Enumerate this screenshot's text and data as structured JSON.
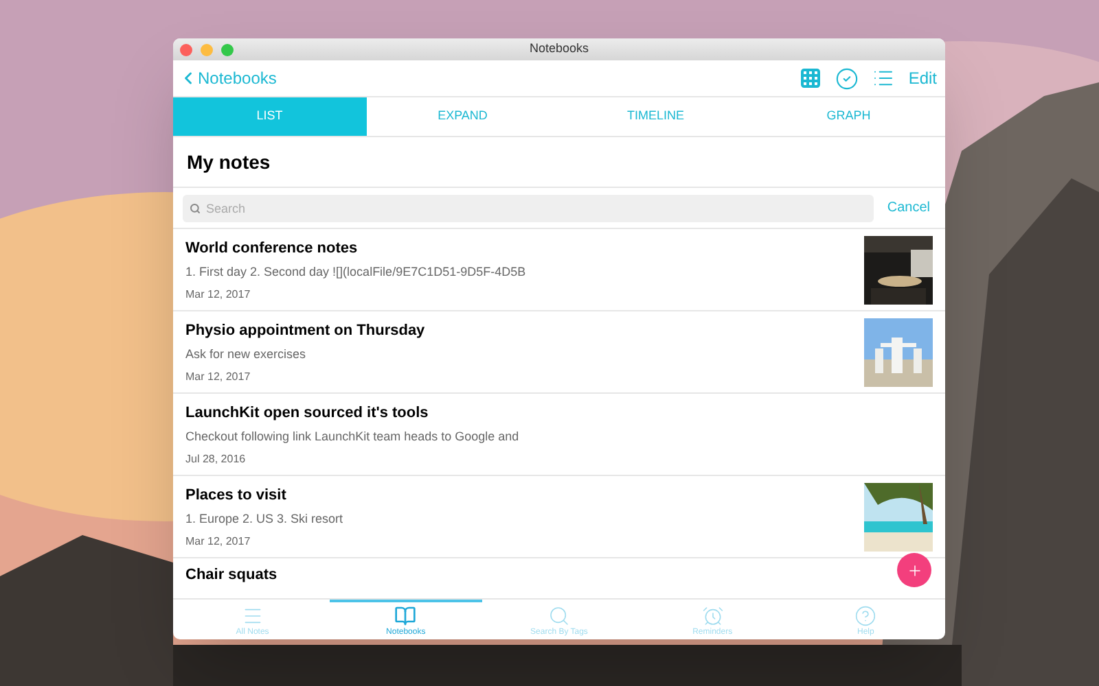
{
  "window": {
    "title": "Notebooks"
  },
  "nav": {
    "back": "Notebooks",
    "edit": "Edit"
  },
  "tabs": [
    {
      "label": "LIST",
      "selected": true
    },
    {
      "label": "EXPAND",
      "selected": false
    },
    {
      "label": "TIMELINE",
      "selected": false
    },
    {
      "label": "GRAPH",
      "selected": false
    }
  ],
  "heading": "My notes",
  "search": {
    "placeholder": "Search",
    "cancel": "Cancel"
  },
  "notes": [
    {
      "title": "World conference notes",
      "snippet": "1. First day 2. Second day ![](localFile/9E7C1D51-9D5F-4D5B",
      "date": "Mar 12, 2017"
    },
    {
      "title": "Physio appointment on Thursday",
      "snippet": "Ask for new exercises",
      "date": "Mar 12, 2017"
    },
    {
      "title": "LaunchKit open sourced it's tools",
      "snippet": "Checkout following link LaunchKit team heads to Google and",
      "date": "Jul 28, 2016"
    },
    {
      "title": "Places to visit",
      "snippet": "1. Europe 2. US 3. Ski resort",
      "date": "Mar 12, 2017"
    },
    {
      "title": "Chair squats"
    }
  ],
  "bottom_tabs": [
    {
      "label": "All Notes",
      "selected": false
    },
    {
      "label": "Notebooks",
      "selected": true
    },
    {
      "label": "Search By Tags",
      "selected": false
    },
    {
      "label": "Reminders",
      "selected": false
    },
    {
      "label": "Help",
      "selected": false
    }
  ]
}
